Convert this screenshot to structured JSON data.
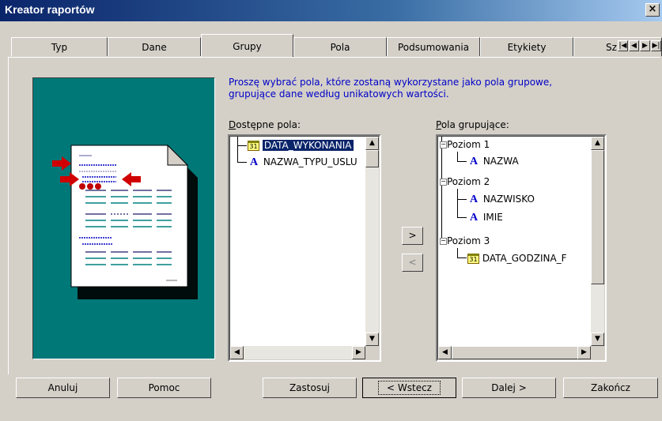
{
  "window": {
    "title": "Kreator raportów",
    "close_glyph": "×"
  },
  "tabs": [
    {
      "label": "Typ"
    },
    {
      "label": "Dane"
    },
    {
      "label": "Grupy"
    },
    {
      "label": "Pola"
    },
    {
      "label": "Podsumowania"
    },
    {
      "label": "Etykiety"
    },
    {
      "label": "Sz"
    }
  ],
  "active_tab": "Grupy",
  "instructions": "Proszę wybrać pola, które zostaną wykorzystane jako pola grupowe, grupujące dane według unikatowych wartości.",
  "available": {
    "label_first": "D",
    "label_rest": "ostępne pola:",
    "items": [
      {
        "label": "DATA_WYKONANIA",
        "icon": "calendar-icon",
        "selected": true
      },
      {
        "label": "NAZWA_TYPU_USLU",
        "icon": "text-field-icon",
        "selected": false
      }
    ]
  },
  "grouping": {
    "label_first": "P",
    "label_rest": "ola grupujące:",
    "levels": [
      {
        "label": "Poziom 1",
        "fields": [
          {
            "label": "NAZWA",
            "icon": "text-field-icon"
          }
        ]
      },
      {
        "label": "Poziom 2",
        "fields": [
          {
            "label": "NAZWISKO",
            "icon": "text-field-icon"
          },
          {
            "label": "IMIE",
            "icon": "text-field-icon"
          }
        ]
      },
      {
        "label": "Poziom 3",
        "fields": [
          {
            "label": "DATA_GODZINA_F",
            "icon": "calendar-icon"
          }
        ]
      }
    ]
  },
  "move_buttons": {
    "add": ">",
    "remove": "<"
  },
  "buttons": {
    "cancel": "Anuluj",
    "help": "Pomoc",
    "apply": "Zastosuj",
    "back": "< Wstecz",
    "next": "Dalej >",
    "finish": "Zakończ"
  },
  "colors": {
    "title_bar": "#0a246a",
    "illustration_bg": "#007878",
    "instruction_text": "#0000c8",
    "selection": "#0a246a"
  }
}
